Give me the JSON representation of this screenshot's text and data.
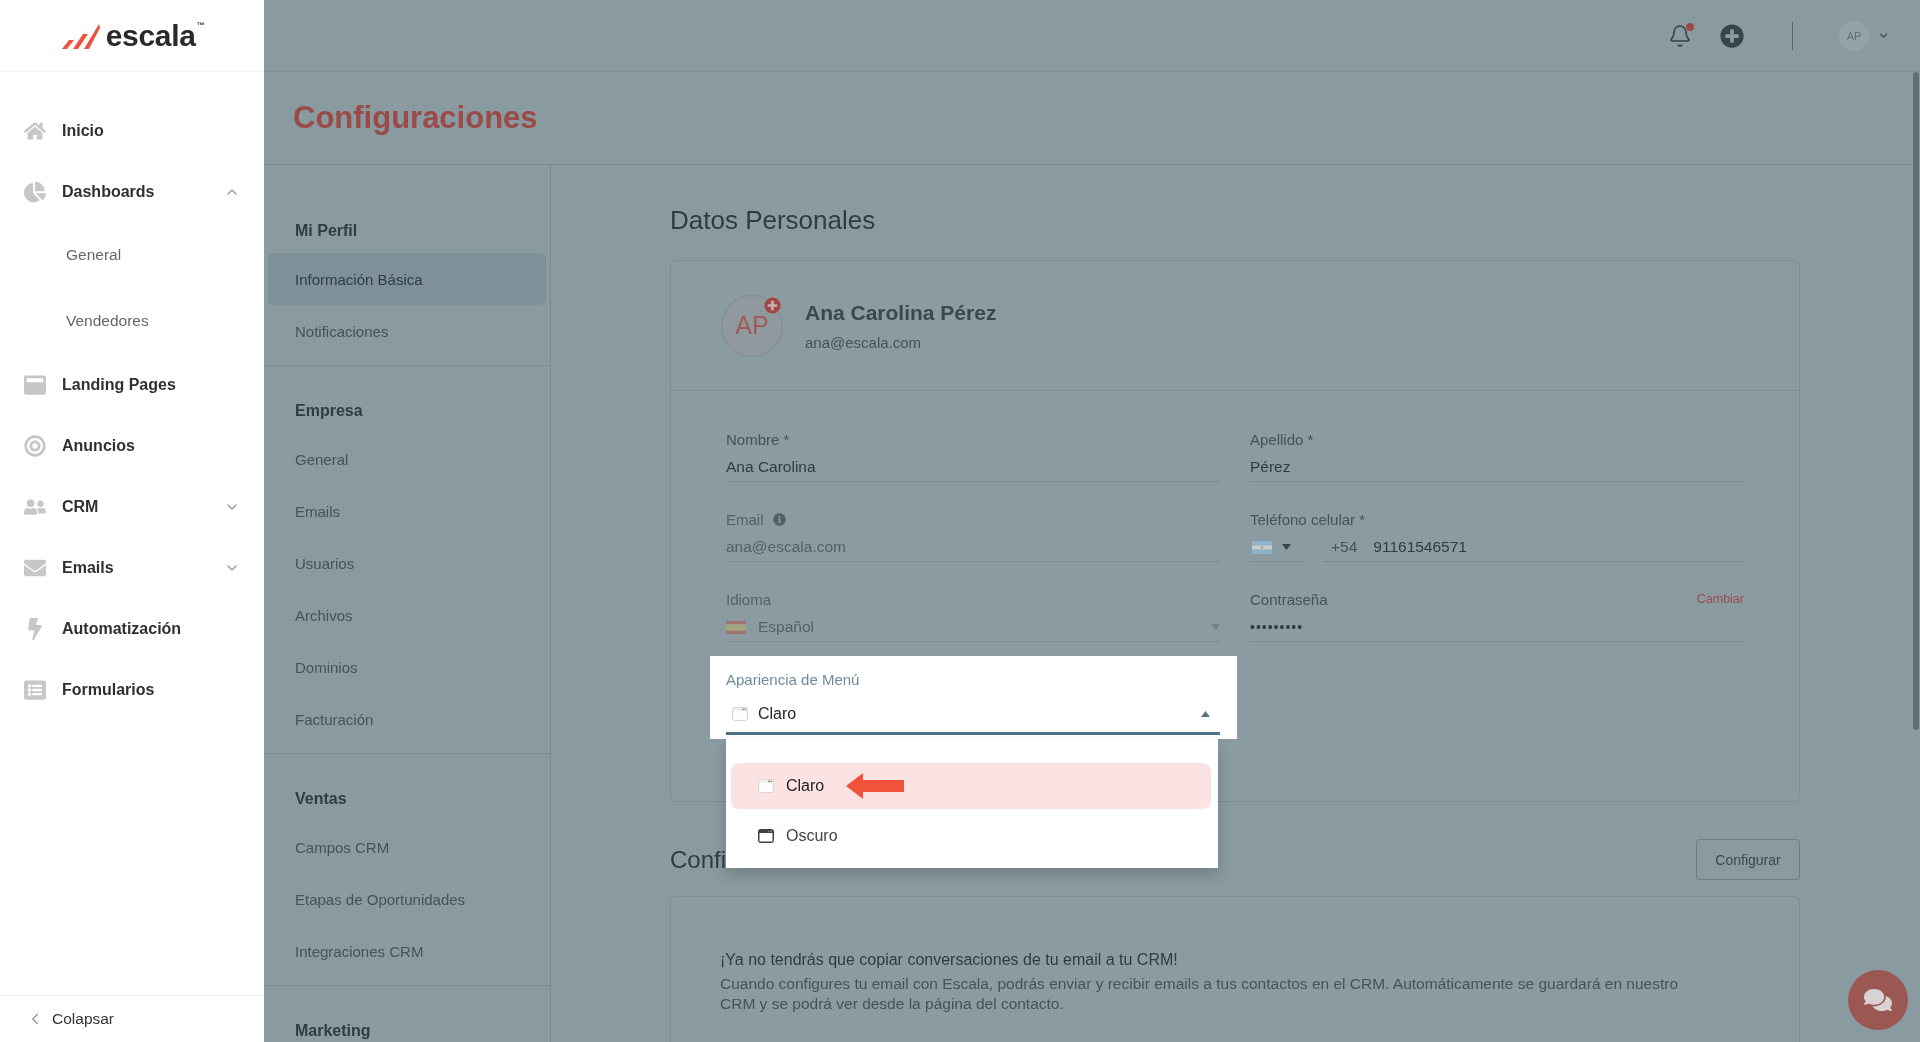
{
  "sidebar": {
    "logo": {
      "text": "escala",
      "trademark": "™"
    },
    "items": [
      {
        "label": "Inicio"
      },
      {
        "label": "Dashboards",
        "expanded": true,
        "children": [
          {
            "label": "General"
          },
          {
            "label": "Vendedores"
          }
        ]
      },
      {
        "label": "Landing Pages"
      },
      {
        "label": "Anuncios"
      },
      {
        "label": "CRM",
        "expanded": false
      },
      {
        "label": "Emails",
        "expanded": false
      },
      {
        "label": "Automatización"
      },
      {
        "label": "Formularios"
      }
    ],
    "collapse": "Colapsar"
  },
  "topbar": {
    "has_unread": true,
    "avatar": "AP"
  },
  "spotlight": {
    "dimmed": true
  },
  "page_title": "Configuraciones",
  "settings_nav": {
    "sections": [
      {
        "title": "Mi Perfil",
        "items": [
          {
            "label": "Información Básica",
            "selected": true
          },
          {
            "label": "Notificaciones",
            "selected": false
          }
        ]
      },
      {
        "title": "Empresa",
        "items": [
          {
            "label": "General",
            "selected": false
          },
          {
            "label": "Emails",
            "selected": false
          },
          {
            "label": "Usuarios",
            "selected": false
          },
          {
            "label": "Archivos",
            "selected": false
          },
          {
            "label": "Dominios",
            "selected": false
          },
          {
            "label": "Facturación",
            "selected": false
          }
        ]
      },
      {
        "title": "Ventas",
        "items": [
          {
            "label": "Campos CRM",
            "selected": false
          },
          {
            "label": "Etapas de Oportunidades",
            "selected": false
          },
          {
            "label": "Integraciones CRM",
            "selected": false
          }
        ]
      },
      {
        "title": "Marketing"
      }
    ]
  },
  "personal_data": {
    "title": "Datos Personales",
    "profile": {
      "initials": "AP",
      "name": "Ana Carolina Pérez",
      "email": "ana@escala.com"
    },
    "fields": [
      {
        "kind": "text",
        "label": "Nombre *",
        "value": "Ana Carolina",
        "disabled": false
      },
      {
        "kind": "text",
        "label": "Apellido *",
        "value": "Pérez",
        "disabled": false
      },
      {
        "kind": "text",
        "label": "Email",
        "value": "ana@escala.com",
        "disabled": true,
        "info": true
      },
      {
        "kind": "phone",
        "label": "Teléfono celular *",
        "prefix": "+54",
        "value": "91161546571",
        "disabled": false
      },
      {
        "kind": "select",
        "label": "Idioma",
        "value": "Español",
        "disabled": true
      },
      {
        "kind": "password",
        "label": "Contraseña",
        "value": "•••••••••",
        "action": "Cambiar",
        "disabled": false
      }
    ],
    "menu_appearance": {
      "label": "Apariencia de Menú",
      "value": "Claro",
      "open": true,
      "options": [
        {
          "label": "Claro",
          "selected": true,
          "arrow": true
        },
        {
          "label": "Oscuro",
          "selected": false,
          "arrow": false
        }
      ]
    }
  },
  "email_config": {
    "title": "Confi",
    "button": "Configurar",
    "headline": "¡Ya no tendrás que copiar conversaciones de tu email a tu CRM!",
    "description": "Cuando configures tu email con Escala, podrás enviar y recibir emails a tus contactos en el CRM. Automáticamente se guardará en nuestro CRM y se podrá ver desde la página del contacto."
  }
}
